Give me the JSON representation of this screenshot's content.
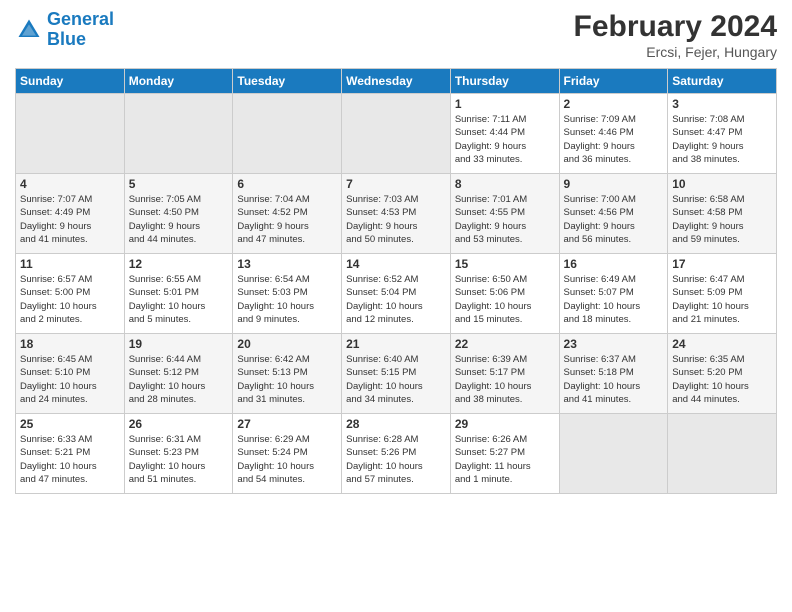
{
  "header": {
    "logo_line1": "General",
    "logo_line2": "Blue",
    "main_title": "February 2024",
    "subtitle": "Ercsi, Fejer, Hungary"
  },
  "days_of_week": [
    "Sunday",
    "Monday",
    "Tuesday",
    "Wednesday",
    "Thursday",
    "Friday",
    "Saturday"
  ],
  "weeks": [
    [
      {
        "day": "",
        "info": ""
      },
      {
        "day": "",
        "info": ""
      },
      {
        "day": "",
        "info": ""
      },
      {
        "day": "",
        "info": ""
      },
      {
        "day": "1",
        "info": "Sunrise: 7:11 AM\nSunset: 4:44 PM\nDaylight: 9 hours\nand 33 minutes."
      },
      {
        "day": "2",
        "info": "Sunrise: 7:09 AM\nSunset: 4:46 PM\nDaylight: 9 hours\nand 36 minutes."
      },
      {
        "day": "3",
        "info": "Sunrise: 7:08 AM\nSunset: 4:47 PM\nDaylight: 9 hours\nand 38 minutes."
      }
    ],
    [
      {
        "day": "4",
        "info": "Sunrise: 7:07 AM\nSunset: 4:49 PM\nDaylight: 9 hours\nand 41 minutes."
      },
      {
        "day": "5",
        "info": "Sunrise: 7:05 AM\nSunset: 4:50 PM\nDaylight: 9 hours\nand 44 minutes."
      },
      {
        "day": "6",
        "info": "Sunrise: 7:04 AM\nSunset: 4:52 PM\nDaylight: 9 hours\nand 47 minutes."
      },
      {
        "day": "7",
        "info": "Sunrise: 7:03 AM\nSunset: 4:53 PM\nDaylight: 9 hours\nand 50 minutes."
      },
      {
        "day": "8",
        "info": "Sunrise: 7:01 AM\nSunset: 4:55 PM\nDaylight: 9 hours\nand 53 minutes."
      },
      {
        "day": "9",
        "info": "Sunrise: 7:00 AM\nSunset: 4:56 PM\nDaylight: 9 hours\nand 56 minutes."
      },
      {
        "day": "10",
        "info": "Sunrise: 6:58 AM\nSunset: 4:58 PM\nDaylight: 9 hours\nand 59 minutes."
      }
    ],
    [
      {
        "day": "11",
        "info": "Sunrise: 6:57 AM\nSunset: 5:00 PM\nDaylight: 10 hours\nand 2 minutes."
      },
      {
        "day": "12",
        "info": "Sunrise: 6:55 AM\nSunset: 5:01 PM\nDaylight: 10 hours\nand 5 minutes."
      },
      {
        "day": "13",
        "info": "Sunrise: 6:54 AM\nSunset: 5:03 PM\nDaylight: 10 hours\nand 9 minutes."
      },
      {
        "day": "14",
        "info": "Sunrise: 6:52 AM\nSunset: 5:04 PM\nDaylight: 10 hours\nand 12 minutes."
      },
      {
        "day": "15",
        "info": "Sunrise: 6:50 AM\nSunset: 5:06 PM\nDaylight: 10 hours\nand 15 minutes."
      },
      {
        "day": "16",
        "info": "Sunrise: 6:49 AM\nSunset: 5:07 PM\nDaylight: 10 hours\nand 18 minutes."
      },
      {
        "day": "17",
        "info": "Sunrise: 6:47 AM\nSunset: 5:09 PM\nDaylight: 10 hours\nand 21 minutes."
      }
    ],
    [
      {
        "day": "18",
        "info": "Sunrise: 6:45 AM\nSunset: 5:10 PM\nDaylight: 10 hours\nand 24 minutes."
      },
      {
        "day": "19",
        "info": "Sunrise: 6:44 AM\nSunset: 5:12 PM\nDaylight: 10 hours\nand 28 minutes."
      },
      {
        "day": "20",
        "info": "Sunrise: 6:42 AM\nSunset: 5:13 PM\nDaylight: 10 hours\nand 31 minutes."
      },
      {
        "day": "21",
        "info": "Sunrise: 6:40 AM\nSunset: 5:15 PM\nDaylight: 10 hours\nand 34 minutes."
      },
      {
        "day": "22",
        "info": "Sunrise: 6:39 AM\nSunset: 5:17 PM\nDaylight: 10 hours\nand 38 minutes."
      },
      {
        "day": "23",
        "info": "Sunrise: 6:37 AM\nSunset: 5:18 PM\nDaylight: 10 hours\nand 41 minutes."
      },
      {
        "day": "24",
        "info": "Sunrise: 6:35 AM\nSunset: 5:20 PM\nDaylight: 10 hours\nand 44 minutes."
      }
    ],
    [
      {
        "day": "25",
        "info": "Sunrise: 6:33 AM\nSunset: 5:21 PM\nDaylight: 10 hours\nand 47 minutes."
      },
      {
        "day": "26",
        "info": "Sunrise: 6:31 AM\nSunset: 5:23 PM\nDaylight: 10 hours\nand 51 minutes."
      },
      {
        "day": "27",
        "info": "Sunrise: 6:29 AM\nSunset: 5:24 PM\nDaylight: 10 hours\nand 54 minutes."
      },
      {
        "day": "28",
        "info": "Sunrise: 6:28 AM\nSunset: 5:26 PM\nDaylight: 10 hours\nand 57 minutes."
      },
      {
        "day": "29",
        "info": "Sunrise: 6:26 AM\nSunset: 5:27 PM\nDaylight: 11 hours\nand 1 minute."
      },
      {
        "day": "",
        "info": ""
      },
      {
        "day": "",
        "info": ""
      }
    ]
  ]
}
